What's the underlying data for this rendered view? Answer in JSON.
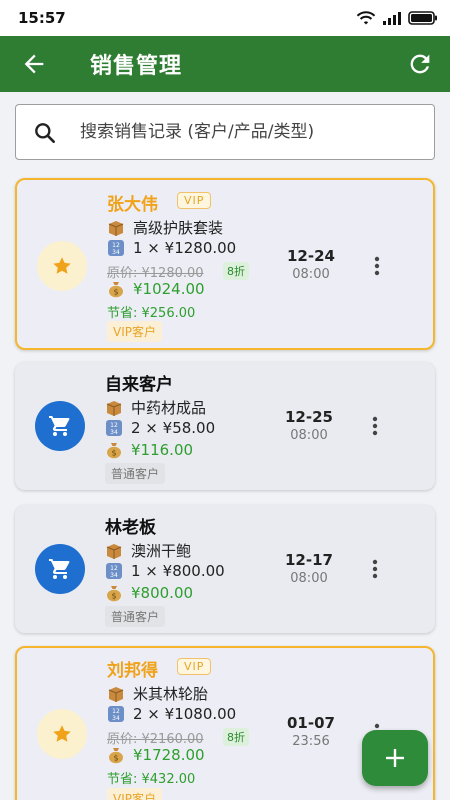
{
  "status_bar": {
    "time": "15:57"
  },
  "app_bar": {
    "title": "销售管理"
  },
  "search": {
    "placeholder": "搜索销售记录 (客户/产品/类型)"
  },
  "records": [
    {
      "customer": "张大伟",
      "vip_badge": "VIP",
      "product": "高级护肤套装",
      "quantity_line": "1 × ¥1280.00",
      "original_price": "原价: ¥1280.00",
      "discount": "8折",
      "total": "¥1024.00",
      "savings": "节省: ¥256.00",
      "tag": "VIP客户",
      "date": "12-24",
      "time": "08:00",
      "icon": "star-icon"
    },
    {
      "customer": "自来客户",
      "product": "中药材成品",
      "quantity_line": "2 × ¥58.00",
      "total": "¥116.00",
      "tag": "普通客户",
      "date": "12-25",
      "time": "08:00",
      "icon": "cart-icon"
    },
    {
      "customer": "林老板",
      "product": "澳洲干鲍",
      "quantity_line": "1 × ¥800.00",
      "total": "¥800.00",
      "tag": "普通客户",
      "date": "12-17",
      "time": "08:00",
      "icon": "cart-icon"
    },
    {
      "customer": "刘邦得",
      "vip_badge": "VIP",
      "product": "米其林轮胎",
      "quantity_line": "2 × ¥1080.00",
      "original_price": "原价: ¥2160.00",
      "discount": "8折",
      "total": "¥1728.00",
      "savings": "节省: ¥432.00",
      "tag": "VIP客户",
      "date": "01-07",
      "time": "23:56",
      "icon": "star-icon"
    }
  ],
  "fab": {
    "label": "+"
  },
  "colors": {
    "primary": "#2e7d32",
    "vip_border": "#f5b62e",
    "cart_avatar": "#1e6fd0",
    "price_green": "#2e9e2e"
  }
}
